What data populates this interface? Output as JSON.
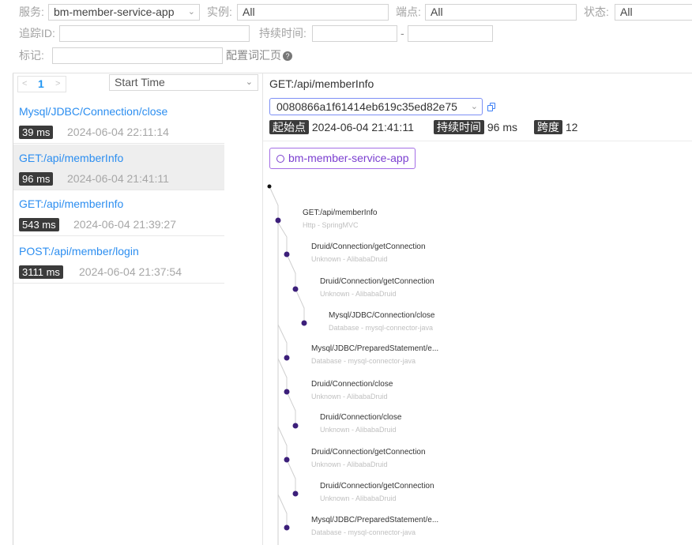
{
  "filters": {
    "service_label": "服务:",
    "service_value": "bm-member-service-app",
    "instance_label": "实例:",
    "instance_value": "All",
    "endpoint_label": "端点:",
    "endpoint_value": "All",
    "status_label": "状态:",
    "status_value": "All",
    "trace_id_label": "追踪ID:",
    "trace_id_value": "",
    "duration_label": "持续时间:",
    "duration_min": "",
    "duration_sep": "-",
    "duration_max": "",
    "tags_label": "标记:",
    "tags_value": "",
    "config_vocab": "配置词汇页"
  },
  "list": {
    "page": "1",
    "sort": "Start Time",
    "traces": [
      {
        "endpoint": "Mysql/JDBC/Connection/close",
        "duration": "39 ms",
        "time": "2024-06-04 22:11:14"
      },
      {
        "endpoint": "GET:/api/memberInfo",
        "duration": "96 ms",
        "time": "2024-06-04 21:41:11"
      },
      {
        "endpoint": "GET:/api/memberInfo",
        "duration": "543 ms",
        "time": "2024-06-04 21:39:27"
      },
      {
        "endpoint": "POST:/api/member/login",
        "duration": "3111 ms",
        "time": "2024-06-04 21:37:54"
      }
    ]
  },
  "detail": {
    "title": "GET:/api/memberInfo",
    "trace_id": "0080866a1f61414eb619c35ed82e75",
    "start_label": "起始点",
    "start_value": "2024-06-04 21:41:11",
    "duration_label": "持续时间",
    "duration_value": "96 ms",
    "span_label": "跨度",
    "span_value": "12",
    "service": "bm-member-service-app",
    "spans": [
      {
        "name": "GET:/api/memberInfo",
        "meta": "Http - SpringMVC"
      },
      {
        "name": "Druid/Connection/getConnection",
        "meta": "Unknown - AlibabaDruid"
      },
      {
        "name": "Druid/Connection/getConnection",
        "meta": "Unknown - AlibabaDruid"
      },
      {
        "name": "Mysql/JDBC/Connection/close",
        "meta": "Database - mysql-connector-java"
      },
      {
        "name": "Mysql/JDBC/PreparedStatement/e...",
        "meta": "Database - mysql-connector-java"
      },
      {
        "name": "Druid/Connection/close",
        "meta": "Unknown - AlibabaDruid"
      },
      {
        "name": "Druid/Connection/close",
        "meta": "Unknown - AlibabaDruid"
      },
      {
        "name": "Druid/Connection/getConnection",
        "meta": "Unknown - AlibabaDruid"
      },
      {
        "name": "Druid/Connection/getConnection",
        "meta": "Unknown - AlibabaDruid"
      },
      {
        "name": "Mysql/JDBC/PreparedStatement/e...",
        "meta": "Database - mysql-connector-java"
      }
    ]
  },
  "colors": {
    "link": "#2c8ef0",
    "node": "#3c1f7a",
    "service_chip": "#7b3fd0",
    "badge_bg": "#3b3b3b"
  }
}
